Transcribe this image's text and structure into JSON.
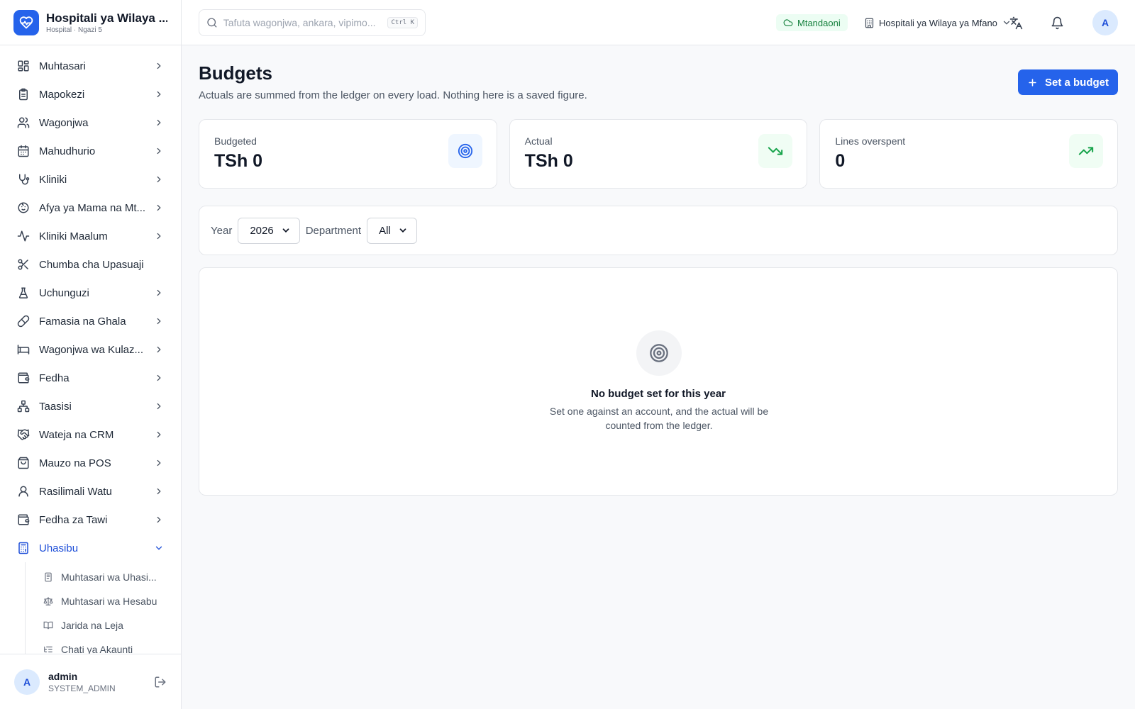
{
  "brand": {
    "title": "Hospitali ya Wilaya ...",
    "subtitle": "Hospital · Ngazi 5",
    "accent": "#2563eb",
    "icon": "heart-pulse-icon"
  },
  "sidebar": {
    "items": [
      {
        "label": "Muhtasari",
        "icon": "layout-grid-icon",
        "has_chevron": true
      },
      {
        "label": "Mapokezi",
        "icon": "clipboard-icon",
        "has_chevron": true
      },
      {
        "label": "Wagonjwa",
        "icon": "users-icon",
        "has_chevron": true
      },
      {
        "label": "Mahudhurio",
        "icon": "calendar-icon",
        "has_chevron": true
      },
      {
        "label": "Kliniki",
        "icon": "stethoscope-icon",
        "has_chevron": true
      },
      {
        "label": "Afya ya Mama na Mt...",
        "icon": "baby-icon",
        "has_chevron": true
      },
      {
        "label": "Kliniki Maalum",
        "icon": "activity-icon",
        "has_chevron": true
      },
      {
        "label": "Chumba cha Upasuaji",
        "icon": "scissors-icon",
        "has_chevron": false
      },
      {
        "label": "Uchunguzi",
        "icon": "flask-icon",
        "has_chevron": true
      },
      {
        "label": "Famasia na Ghala",
        "icon": "pill-icon",
        "has_chevron": true
      },
      {
        "label": "Wagonjwa wa Kulaz...",
        "icon": "bed-icon",
        "has_chevron": true
      },
      {
        "label": "Fedha",
        "icon": "wallet-icon",
        "has_chevron": true
      },
      {
        "label": "Taasisi",
        "icon": "network-icon",
        "has_chevron": true
      },
      {
        "label": "Wateja na CRM",
        "icon": "handshake-icon",
        "has_chevron": true
      },
      {
        "label": "Mauzo na POS",
        "icon": "shopping-bag-icon",
        "has_chevron": true
      },
      {
        "label": "Rasilimali Watu",
        "icon": "user-icon",
        "has_chevron": true
      },
      {
        "label": "Fedha za Tawi",
        "icon": "wallet-icon",
        "has_chevron": true
      },
      {
        "label": "Uhasibu",
        "icon": "calculator-icon",
        "has_chevron": true,
        "active": true
      }
    ],
    "subitems": [
      {
        "label": "Muhtasari wa Uhasi...",
        "icon": "receipt-icon"
      },
      {
        "label": "Muhtasari wa Hesabu",
        "icon": "scale-icon"
      },
      {
        "label": "Jarida na Leja",
        "icon": "book-open-icon"
      },
      {
        "label": "Chati ya Akaunti",
        "icon": "list-tree-icon"
      }
    ]
  },
  "user": {
    "initial": "A",
    "name": "admin",
    "role": "SYSTEM_ADMIN"
  },
  "topbar": {
    "search_placeholder": "Tafuta wagonjwa, ankara, vipimo...",
    "search_shortcut": "Ctrl K",
    "status": "Mtandaoni",
    "status_color": "#15803d",
    "org": "Hospitali ya Wilaya ya Mfano",
    "avatar_initial": "A"
  },
  "page": {
    "title": "Budgets",
    "subtitle": "Actuals are summed from the ledger on every load. Nothing here is a saved figure.",
    "primary_action": "Set a budget"
  },
  "stats": [
    {
      "label": "Budgeted",
      "value": "TSh 0",
      "icon": "target-icon",
      "tone": "blue"
    },
    {
      "label": "Actual",
      "value": "TSh 0",
      "icon": "trending-down-icon",
      "tone": "green"
    },
    {
      "label": "Lines overspent",
      "value": "0",
      "icon": "trending-up-icon",
      "tone": "green"
    }
  ],
  "filters": {
    "year_label": "Year",
    "year_value": "2026",
    "department_label": "Department",
    "department_value": "All"
  },
  "empty_state": {
    "title": "No budget set for this year",
    "description": "Set one against an account, and the actual will be counted from the ledger."
  }
}
